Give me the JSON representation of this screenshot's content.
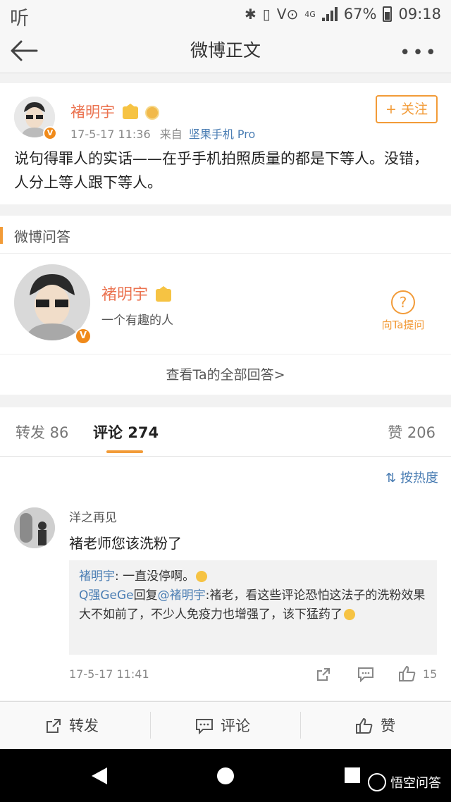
{
  "status_bar": {
    "app_glyph": "听",
    "battery_text": "67%",
    "time": "09:18",
    "network": "4G"
  },
  "nav": {
    "title": "微博正文"
  },
  "post": {
    "author": "褚明宇",
    "time": "17-5-17 11:36",
    "source_prefix": "来自",
    "source": "坚果手机 Pro",
    "follow_label": "+ 关注",
    "text": "说句得罪人的实话——在乎手机拍照质量的都是下等人。没错，人分上等人跟下等人。"
  },
  "qa": {
    "section_title": "微博问答",
    "name": "褚明宇",
    "bio": "一个有趣的人",
    "ask_label": "向Ta提问",
    "ask_icon": "?",
    "view_all": "查看Ta的全部回答>"
  },
  "tabs": {
    "repost": "转发 86",
    "comment": "评论 274",
    "like": "赞 206"
  },
  "sort_label": "按热度",
  "comment": {
    "user": "洋之再见",
    "text": "褚老师您该洗粉了",
    "reply1_user": "褚明宇",
    "reply1_text": ": 一直没停啊。",
    "reply2_user": "Q强GeGe",
    "reply2_mid": "回复",
    "reply2_target": "@褚明宇",
    "reply2_text": ":褚老，看这些评论恐怕这法子的洗粉效果大不如前了，不少人免疫力也增强了，该下猛药了",
    "time": "17-5-17 11:41",
    "like_count": "15"
  },
  "actions": {
    "repost": "转发",
    "comment": "评论",
    "like": "赞"
  },
  "watermark": "悟空问答",
  "colors": {
    "accent": "#f29b38",
    "username": "#eb7350",
    "link": "#4a7db3"
  }
}
